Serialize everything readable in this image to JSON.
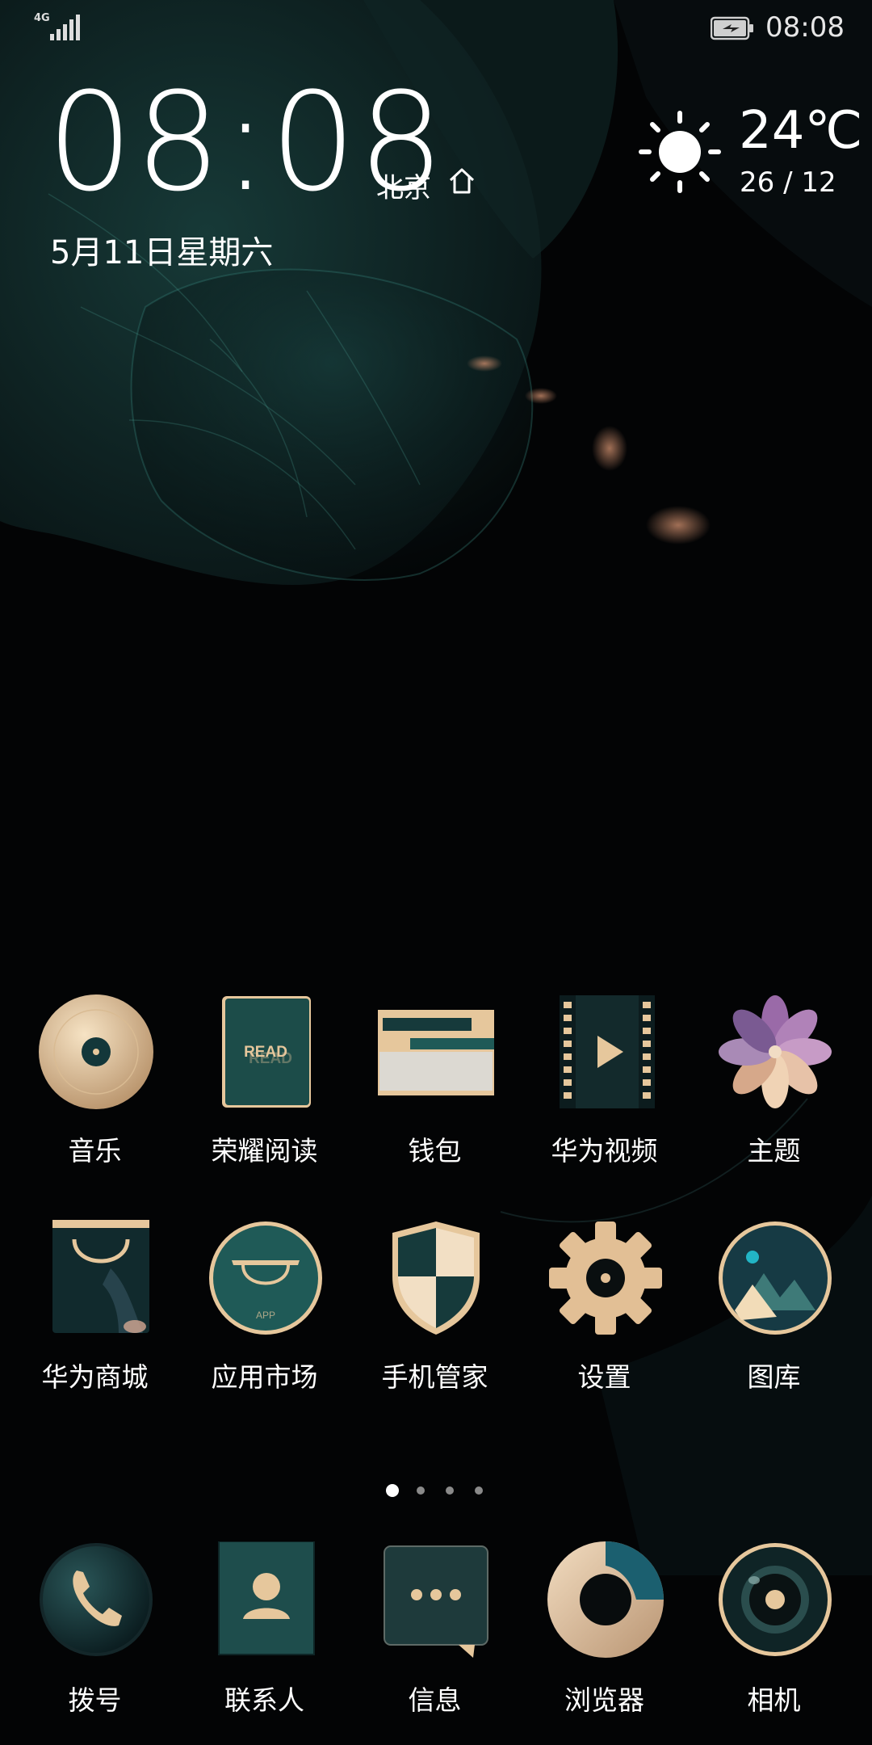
{
  "status_bar": {
    "network": "4G",
    "time": "08:08"
  },
  "clock_widget": {
    "time": "08:08",
    "city": "北京",
    "date": "5月11日星期六"
  },
  "weather": {
    "temperature": "24℃",
    "range": "26 / 12",
    "icon": "sun-icon"
  },
  "apps": [
    {
      "label": "音乐",
      "icon": "music-disc-icon"
    },
    {
      "label": "荣耀阅读",
      "icon": "book-read-icon"
    },
    {
      "label": "钱包",
      "icon": "wallet-card-icon"
    },
    {
      "label": "华为视频",
      "icon": "video-film-icon"
    },
    {
      "label": "主题",
      "icon": "theme-pinwheel-icon"
    },
    {
      "label": "华为商城",
      "icon": "shopping-bag-icon"
    },
    {
      "label": "应用市场",
      "icon": "app-market-icon"
    },
    {
      "label": "手机管家",
      "icon": "shield-icon"
    },
    {
      "label": "设置",
      "icon": "gear-icon"
    },
    {
      "label": "图库",
      "icon": "gallery-mountain-icon"
    }
  ],
  "dock": [
    {
      "label": "拨号",
      "icon": "phone-icon"
    },
    {
      "label": "联系人",
      "icon": "contact-icon"
    },
    {
      "label": "信息",
      "icon": "message-icon"
    },
    {
      "label": "浏览器",
      "icon": "browser-icon"
    },
    {
      "label": "相机",
      "icon": "camera-icon"
    }
  ],
  "pager": {
    "pages": 4,
    "active": 0
  },
  "icon_text": {
    "read": "READ",
    "app": "APP"
  },
  "colors": {
    "gold": "#e6c79c",
    "teal": "#1f5a57",
    "dark_teal": "#163a3b",
    "background": "#030405"
  }
}
